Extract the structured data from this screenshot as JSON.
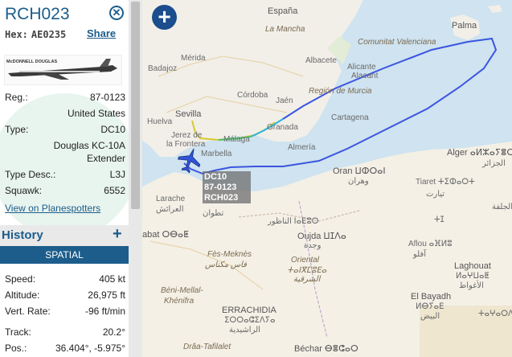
{
  "header": {
    "callsign": "RCH023",
    "hex_label": "Hex:",
    "hex_value": "AE0235",
    "share_label": "Share"
  },
  "photo": {
    "logo_text": "McDONNELL DOUGLAS"
  },
  "details": [
    {
      "label": "Reg.:",
      "value": "87-0123"
    },
    {
      "label": "",
      "value": "United States"
    },
    {
      "label": "Type:",
      "value": "DC10"
    },
    {
      "label": "",
      "value": "Douglas KC-10A"
    },
    {
      "label": "",
      "value": "Extender"
    },
    {
      "label": "Type Desc.:",
      "value": "L3J"
    },
    {
      "label": "Squawk:",
      "value": "6552"
    }
  ],
  "planespotters_link": "View on Planespotters",
  "history": {
    "title": "History",
    "plus": "+"
  },
  "spatial_label": "SPATIAL",
  "spatial": [
    {
      "label": "Speed:",
      "value": "405 kt"
    },
    {
      "label": "Altitude:",
      "value": "26,975 ft"
    },
    {
      "label": "Vert. Rate:",
      "value": "-96 ft/min"
    },
    {
      "label": "Track:",
      "value": "20.2°"
    },
    {
      "label": "Pos.:",
      "value": "36.404°, -5.975°"
    }
  ],
  "map": {
    "zoom_in": "+",
    "aircraft_label": [
      "DC10",
      "87-0123",
      "RCH023"
    ],
    "labels": {
      "espana": "España",
      "la_mancha": "La Mancha",
      "badajoz": "Badajoz",
      "merida": "Mérida",
      "albacete": "Albacete",
      "c_valenciana": "Comunitat Valenciana",
      "alicante": "Alicante",
      "alacant": "Alacant",
      "cordoba": "Córdoba",
      "jaen": "Jaén",
      "sevilla": "Sevilla",
      "region_murcia": "Región de Murcia",
      "huelva": "Huelva",
      "granada": "Granada",
      "cartagena": "Cartagena",
      "jerez": "Jerez de",
      "frontera": "la Frontera",
      "malaga": "Málaga",
      "almeria": "Almería",
      "marbella": "Marbella",
      "palma": "Palma",
      "alger": "Alger",
      "alger_ar": "ⴰⵍⵣⴰⵢⴻⵔ",
      "jazair": "الجزائر",
      "oran": "Oran ⵡⵀⵔⴰⵏ",
      "wahran": "وهران",
      "tiaret": "Tiaret ⵜⵉⵀⴰⵔⵜ",
      "tihart": "تيارت",
      "larache": "Larache",
      "laraich": "العرائش",
      "tetouan": "تطوان",
      "nador": "الناظور ⵏⴰⴹⵓⵔ",
      "oujda": "Oujda ⵡⵊⴷⴰ",
      "wajda": "وجدة",
      "rabat": "abat ⵔⴱⴰⵟ",
      "fes_meknes": "Fès-Meknès",
      "fes_ar": "فاس مكناس",
      "oriental": "Oriental",
      "oriental_ar": "ⵜⴰⵏⴳⵎⵓⴹⴰ",
      "sharqia": "الشرقية",
      "beni_mellal": "Béni-Mellal-",
      "khenifra": "Khénifra",
      "errachidia": "ERRACHIDIA",
      "errachidia_ar": "ⵉⵔⵔⴰⵛⵉⴷⵢⴰ",
      "rashidia": "الراشيدية",
      "draa": "Drâa-Tafilalet",
      "el_bayadh": "El Bayadh",
      "el_bayadh_ar": "ⵍⴱⵢⴰⴹ",
      "bayadh": "البيض",
      "bechar": "Béchar ⴱⴻⵛⴰⵔ",
      "laghouat": "Laghouat",
      "laghouat_ar": "ⵍⴰⵖⵡⴰⵟ",
      "aghwat": "الأغواط",
      "djelfa": "الجلفة",
      "aflou": "Aflou ⴰⴼⵍⵓ",
      "aflou_ar": "آفلو",
      "tajn": "ⵜⵊ",
      "ghardaia": "ⵜⴰⵖⴰⵔⴷⴰⵢⵜ"
    }
  },
  "colors": {
    "accent": "#1c5d8c",
    "track_main": "#3a55e0",
    "spatial_bg": "#1c5d8c"
  }
}
